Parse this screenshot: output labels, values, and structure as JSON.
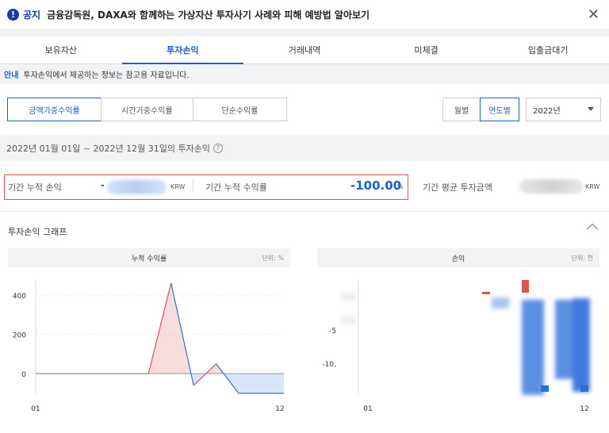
{
  "notice": {
    "tag": "공지",
    "text": "금융감독원, DAXA와 함께하는 가상자산 투자사기 사례와 피해 예방법 알아보기",
    "close": "✕"
  },
  "tabs": [
    "보유자산",
    "투자손익",
    "거래내역",
    "미체결",
    "입출금대기"
  ],
  "info": {
    "label": "안내",
    "text": "투자손익에서 제공하는 정보는 참고용 자료입니다."
  },
  "segments": [
    "금액가중수익률",
    "시간가중수익률",
    "단순수익률"
  ],
  "period_toggle": [
    "월별",
    "연도별"
  ],
  "year": "2022년",
  "period": "2022년 01월 01일 ~ 2022년 12월 31일의 투자손익",
  "summary": {
    "cum_pnl_label": "기간 누적 손익",
    "cum_pnl_prefix": "-",
    "krw": "KRW",
    "cum_rate_label": "기간 누적 수익률",
    "cum_rate_value": "-100.00",
    "pct": "%",
    "avg_label": "기간 평균 투자금액",
    "krw2": "KRW"
  },
  "graph_title": "투자손익 그래프",
  "chart_data": [
    {
      "type": "line",
      "title": "누적 수익률",
      "unit": "단위: %",
      "x": [
        1,
        2,
        3,
        4,
        5,
        6,
        7,
        8,
        9,
        10,
        11,
        12
      ],
      "values": [
        0,
        0,
        0,
        0,
        0,
        0,
        460,
        -60,
        50,
        -100,
        -100,
        -100
      ],
      "yticks": [
        "400",
        "200",
        "0"
      ],
      "xticks": [
        "01",
        "12"
      ],
      "ylim": [
        -100,
        480
      ]
    },
    {
      "type": "bar",
      "title": "손익",
      "unit": "단위: 천",
      "yticks": [
        "-5",
        "-10,"
      ],
      "xticks": [
        "01",
        "12"
      ]
    }
  ],
  "colors": {
    "accent": "#1a5ecf",
    "up": "#d9534f",
    "down": "#2b6fd6",
    "redbox": "#e05050"
  }
}
